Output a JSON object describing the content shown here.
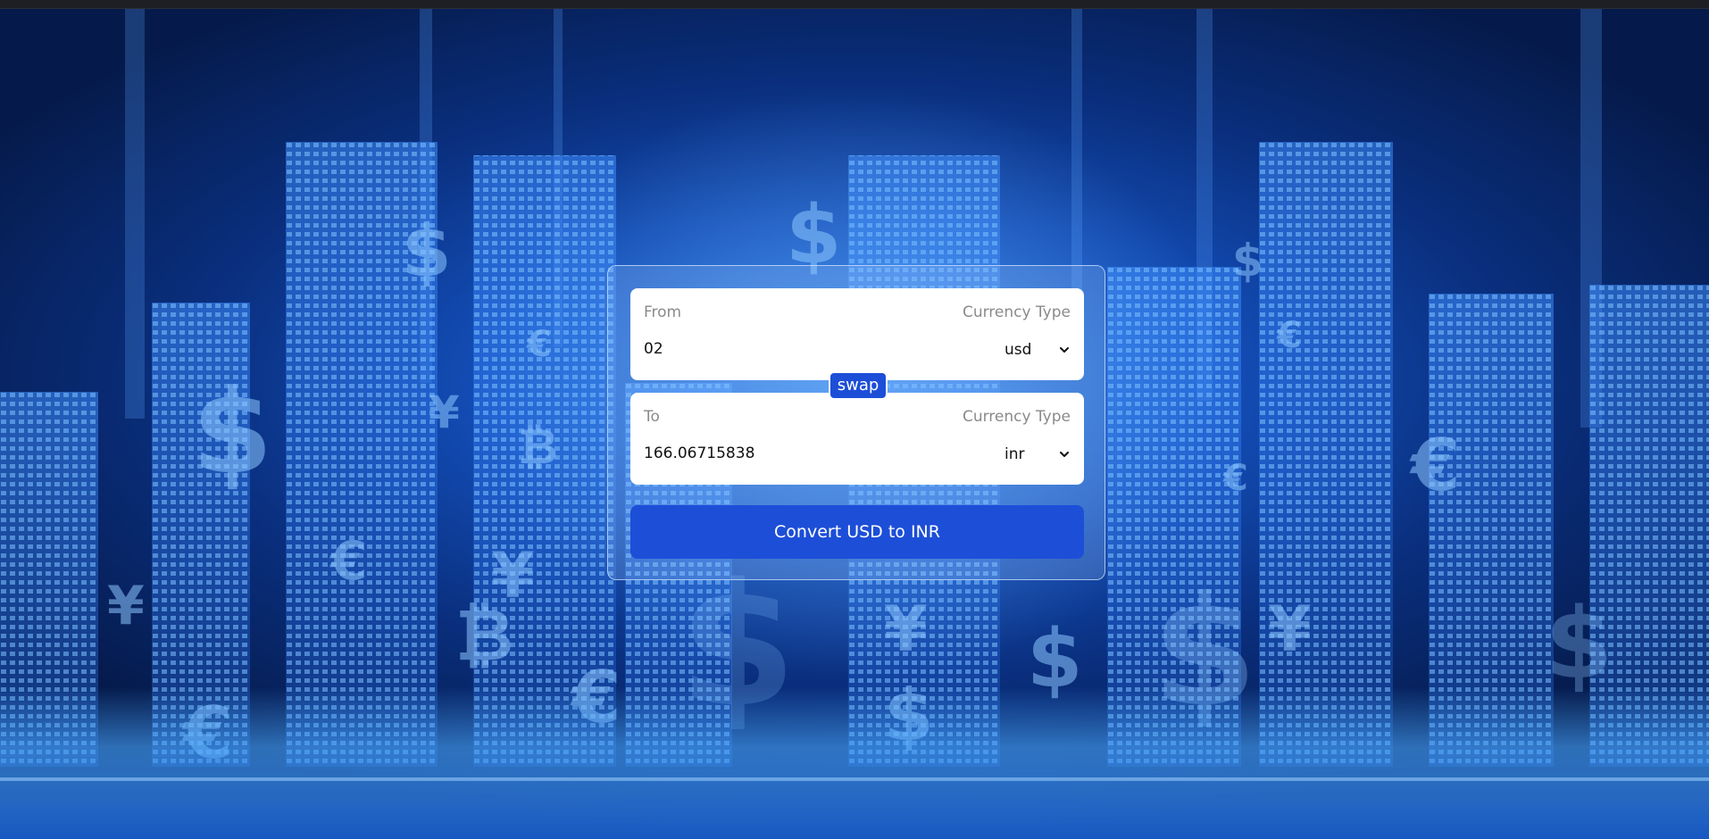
{
  "colors": {
    "accent": "#1d4ed8",
    "card_bg": "#ffffff",
    "muted_text": "#8a8a8a"
  },
  "from": {
    "label": "From",
    "currency_type_label": "Currency Type",
    "amount": "02",
    "currency": "usd"
  },
  "swap": {
    "label": "swap"
  },
  "to": {
    "label": "To",
    "currency_type_label": "Currency Type",
    "amount": "166.06715838",
    "currency": "inr"
  },
  "convert": {
    "label": "Convert USD to INR"
  },
  "icons": {
    "dropdown": "chevron-down-icon",
    "background": "city-currency-background"
  }
}
